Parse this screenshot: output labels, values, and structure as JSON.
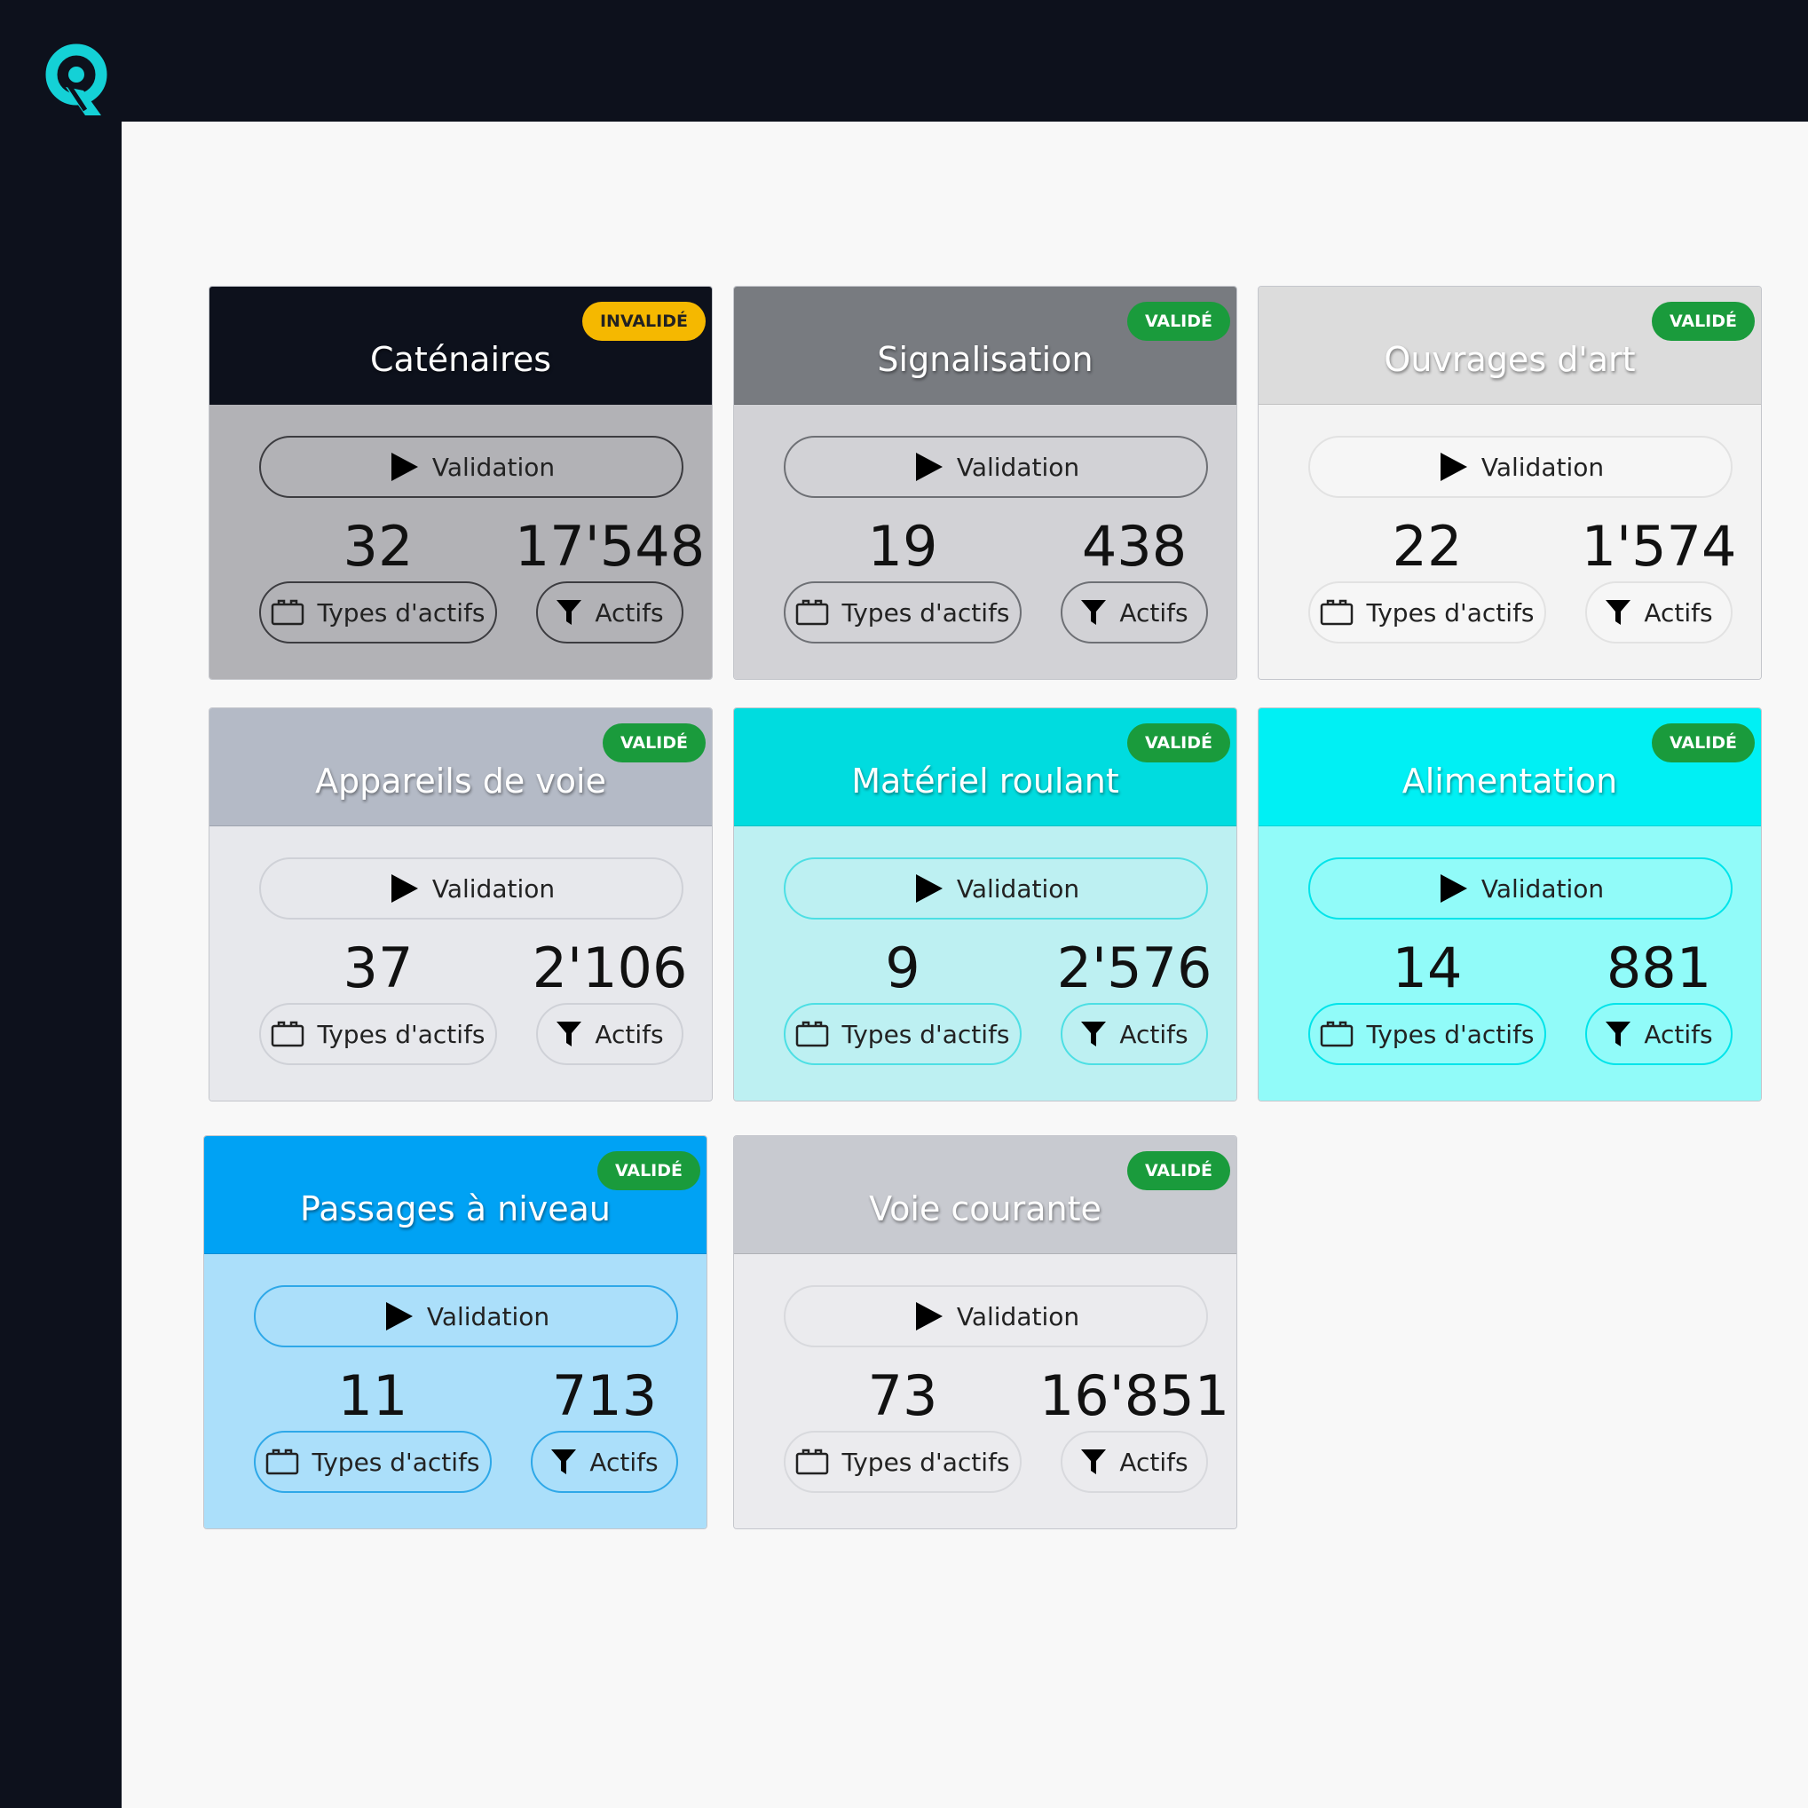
{
  "cards": [
    {
      "title": "Caténaires",
      "status": "INVALIDÉ",
      "validation_label": "Validation",
      "types_count": "32",
      "types_label": "Types d'actifs",
      "assets_count": "17'548",
      "assets_label": "Actifs"
    },
    {
      "title": "Signalisation",
      "status": "VALIDÉ",
      "validation_label": "Validation",
      "types_count": "19",
      "types_label": "Types d'actifs",
      "assets_count": "438",
      "assets_label": "Actifs"
    },
    {
      "title": "Ouvrages d'art",
      "status": "VALIDÉ",
      "validation_label": "Validation",
      "types_count": "22",
      "types_label": "Types d'actifs",
      "assets_count": "1'574",
      "assets_label": "Actifs"
    },
    {
      "title": "Appareils de voie",
      "status": "VALIDÉ",
      "validation_label": "Validation",
      "types_count": "37",
      "types_label": "Types d'actifs",
      "assets_count": "2'106",
      "assets_label": "Actifs"
    },
    {
      "title": "Matériel roulant",
      "status": "VALIDÉ",
      "validation_label": "Validation",
      "types_count": "9",
      "types_label": "Types d'actifs",
      "assets_count": "2'576",
      "assets_label": "Actifs"
    },
    {
      "title": "Alimentation",
      "status": "VALIDÉ",
      "validation_label": "Validation",
      "types_count": "14",
      "types_label": "Types d'actifs",
      "assets_count": "881",
      "assets_label": "Actifs"
    },
    {
      "title": "Passages à niveau",
      "status": "VALIDÉ",
      "validation_label": "Validation",
      "types_count": "11",
      "types_label": "Types d'actifs",
      "assets_count": "713",
      "assets_label": "Actifs"
    },
    {
      "title": "Voie courante",
      "status": "VALIDÉ",
      "validation_label": "Validation",
      "types_count": "73",
      "types_label": "Types d'actifs",
      "assets_count": "16'851",
      "assets_label": "Actifs"
    }
  ],
  "colors": {
    "topbar": "#0d111c",
    "accent": "#14d1d6",
    "status_valid": "#1a9b3c",
    "status_invalid": "#f5b800"
  },
  "icons": {
    "logo": "q-logo-icon",
    "validation": "play-icon",
    "types": "briefcase-icon",
    "assets": "filter-icon"
  }
}
